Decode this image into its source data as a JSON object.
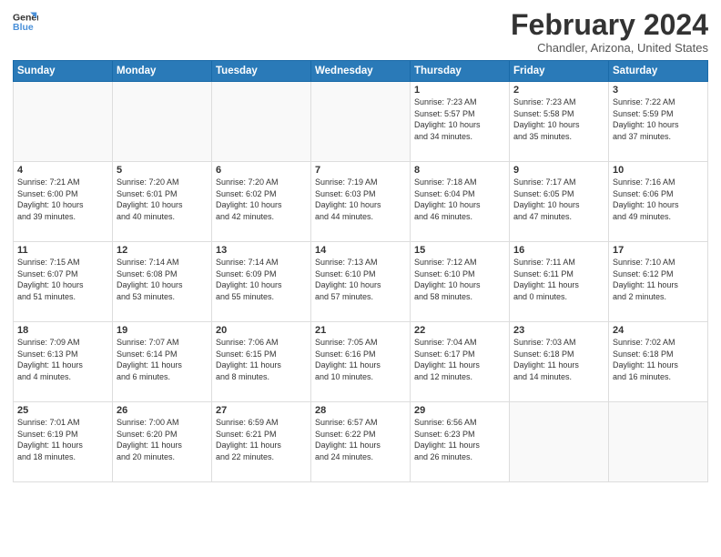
{
  "header": {
    "logo_line1": "General",
    "logo_line2": "Blue",
    "month_year": "February 2024",
    "location": "Chandler, Arizona, United States"
  },
  "weekdays": [
    "Sunday",
    "Monday",
    "Tuesday",
    "Wednesday",
    "Thursday",
    "Friday",
    "Saturday"
  ],
  "weeks": [
    [
      {
        "day": "",
        "content": ""
      },
      {
        "day": "",
        "content": ""
      },
      {
        "day": "",
        "content": ""
      },
      {
        "day": "",
        "content": ""
      },
      {
        "day": "1",
        "content": "Sunrise: 7:23 AM\nSunset: 5:57 PM\nDaylight: 10 hours\nand 34 minutes."
      },
      {
        "day": "2",
        "content": "Sunrise: 7:23 AM\nSunset: 5:58 PM\nDaylight: 10 hours\nand 35 minutes."
      },
      {
        "day": "3",
        "content": "Sunrise: 7:22 AM\nSunset: 5:59 PM\nDaylight: 10 hours\nand 37 minutes."
      }
    ],
    [
      {
        "day": "4",
        "content": "Sunrise: 7:21 AM\nSunset: 6:00 PM\nDaylight: 10 hours\nand 39 minutes."
      },
      {
        "day": "5",
        "content": "Sunrise: 7:20 AM\nSunset: 6:01 PM\nDaylight: 10 hours\nand 40 minutes."
      },
      {
        "day": "6",
        "content": "Sunrise: 7:20 AM\nSunset: 6:02 PM\nDaylight: 10 hours\nand 42 minutes."
      },
      {
        "day": "7",
        "content": "Sunrise: 7:19 AM\nSunset: 6:03 PM\nDaylight: 10 hours\nand 44 minutes."
      },
      {
        "day": "8",
        "content": "Sunrise: 7:18 AM\nSunset: 6:04 PM\nDaylight: 10 hours\nand 46 minutes."
      },
      {
        "day": "9",
        "content": "Sunrise: 7:17 AM\nSunset: 6:05 PM\nDaylight: 10 hours\nand 47 minutes."
      },
      {
        "day": "10",
        "content": "Sunrise: 7:16 AM\nSunset: 6:06 PM\nDaylight: 10 hours\nand 49 minutes."
      }
    ],
    [
      {
        "day": "11",
        "content": "Sunrise: 7:15 AM\nSunset: 6:07 PM\nDaylight: 10 hours\nand 51 minutes."
      },
      {
        "day": "12",
        "content": "Sunrise: 7:14 AM\nSunset: 6:08 PM\nDaylight: 10 hours\nand 53 minutes."
      },
      {
        "day": "13",
        "content": "Sunrise: 7:14 AM\nSunset: 6:09 PM\nDaylight: 10 hours\nand 55 minutes."
      },
      {
        "day": "14",
        "content": "Sunrise: 7:13 AM\nSunset: 6:10 PM\nDaylight: 10 hours\nand 57 minutes."
      },
      {
        "day": "15",
        "content": "Sunrise: 7:12 AM\nSunset: 6:10 PM\nDaylight: 10 hours\nand 58 minutes."
      },
      {
        "day": "16",
        "content": "Sunrise: 7:11 AM\nSunset: 6:11 PM\nDaylight: 11 hours\nand 0 minutes."
      },
      {
        "day": "17",
        "content": "Sunrise: 7:10 AM\nSunset: 6:12 PM\nDaylight: 11 hours\nand 2 minutes."
      }
    ],
    [
      {
        "day": "18",
        "content": "Sunrise: 7:09 AM\nSunset: 6:13 PM\nDaylight: 11 hours\nand 4 minutes."
      },
      {
        "day": "19",
        "content": "Sunrise: 7:07 AM\nSunset: 6:14 PM\nDaylight: 11 hours\nand 6 minutes."
      },
      {
        "day": "20",
        "content": "Sunrise: 7:06 AM\nSunset: 6:15 PM\nDaylight: 11 hours\nand 8 minutes."
      },
      {
        "day": "21",
        "content": "Sunrise: 7:05 AM\nSunset: 6:16 PM\nDaylight: 11 hours\nand 10 minutes."
      },
      {
        "day": "22",
        "content": "Sunrise: 7:04 AM\nSunset: 6:17 PM\nDaylight: 11 hours\nand 12 minutes."
      },
      {
        "day": "23",
        "content": "Sunrise: 7:03 AM\nSunset: 6:18 PM\nDaylight: 11 hours\nand 14 minutes."
      },
      {
        "day": "24",
        "content": "Sunrise: 7:02 AM\nSunset: 6:18 PM\nDaylight: 11 hours\nand 16 minutes."
      }
    ],
    [
      {
        "day": "25",
        "content": "Sunrise: 7:01 AM\nSunset: 6:19 PM\nDaylight: 11 hours\nand 18 minutes."
      },
      {
        "day": "26",
        "content": "Sunrise: 7:00 AM\nSunset: 6:20 PM\nDaylight: 11 hours\nand 20 minutes."
      },
      {
        "day": "27",
        "content": "Sunrise: 6:59 AM\nSunset: 6:21 PM\nDaylight: 11 hours\nand 22 minutes."
      },
      {
        "day": "28",
        "content": "Sunrise: 6:57 AM\nSunset: 6:22 PM\nDaylight: 11 hours\nand 24 minutes."
      },
      {
        "day": "29",
        "content": "Sunrise: 6:56 AM\nSunset: 6:23 PM\nDaylight: 11 hours\nand 26 minutes."
      },
      {
        "day": "",
        "content": ""
      },
      {
        "day": "",
        "content": ""
      }
    ]
  ]
}
